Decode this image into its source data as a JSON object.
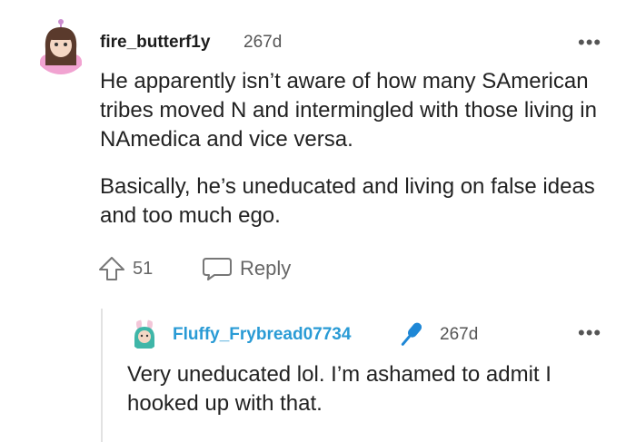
{
  "comment": {
    "username": "fire_butterf1y",
    "age": "267d",
    "paragraphs": [
      "He apparently isn’t aware of how many SAmerican tribes moved N and intermingled with those living in NAmedica and vice versa.",
      "Basically, he’s uneducated and living on false ideas and too much ego."
    ],
    "upvotes": "51",
    "reply_label": "Reply",
    "more_label": "•••"
  },
  "reply": {
    "username": "Fluffy_Frybread07734",
    "age": "267d",
    "text": "Very uneducated lol. I’m ashamed to admit I hooked up with that.",
    "more_label": "•••"
  },
  "colors": {
    "reply_username": "#2a9bd5",
    "badge": "#1e87d6"
  },
  "icons": {
    "upvote": "upvote-arrow-icon",
    "reply": "speech-bubble-icon",
    "badge": "microphone-icon"
  }
}
